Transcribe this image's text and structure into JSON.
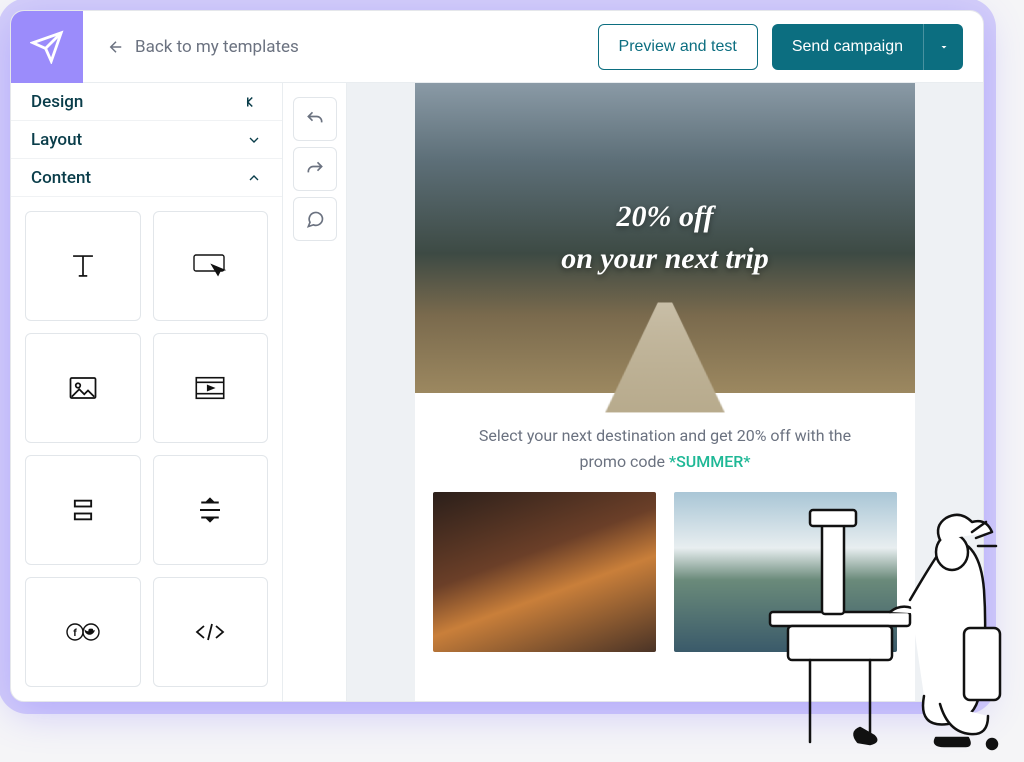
{
  "header": {
    "back_label": "Back to my templates",
    "preview_label": "Preview and test",
    "send_label": "Send campaign"
  },
  "sidebar": {
    "design_label": "Design",
    "layout_label": "Layout",
    "content_label": "Content",
    "blocks": [
      "text",
      "button",
      "image",
      "video",
      "spacer",
      "divider",
      "social",
      "html"
    ]
  },
  "email": {
    "hero_line1": "20% off",
    "hero_line2": "on your next trip",
    "sub_text": "Select your next destination and get 20% off with the promo code ",
    "promo_code": "*SUMMER*"
  }
}
